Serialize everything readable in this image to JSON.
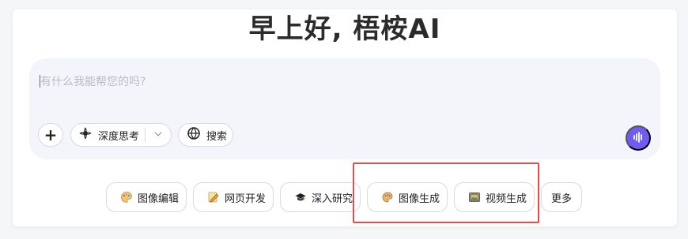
{
  "header": {
    "greeting": "早上好, 梧桉AI"
  },
  "composer": {
    "placeholder": "有什么我能帮您的吗?",
    "value": "",
    "plus_icon": "plus-icon",
    "deep_think_label": "深度思考",
    "deep_think_icon": "sparkle-icon",
    "search_label": "搜索",
    "search_icon": "globe-icon",
    "voice_icon": "voice-wave-icon",
    "voice_color": "#6f5cf4"
  },
  "shortcuts": [
    {
      "label": "图像编辑",
      "icon": "palette-icon"
    },
    {
      "label": "网页开发",
      "icon": "pencil-note-icon"
    },
    {
      "label": "深入研究",
      "icon": "graduation-cap-icon"
    },
    {
      "label": "图像生成",
      "icon": "paint-palette-icon"
    },
    {
      "label": "视频生成",
      "icon": "film-image-icon"
    },
    {
      "label": "更多",
      "icon": ""
    }
  ],
  "annotation": {
    "highlight_color": "#e84b4b"
  }
}
